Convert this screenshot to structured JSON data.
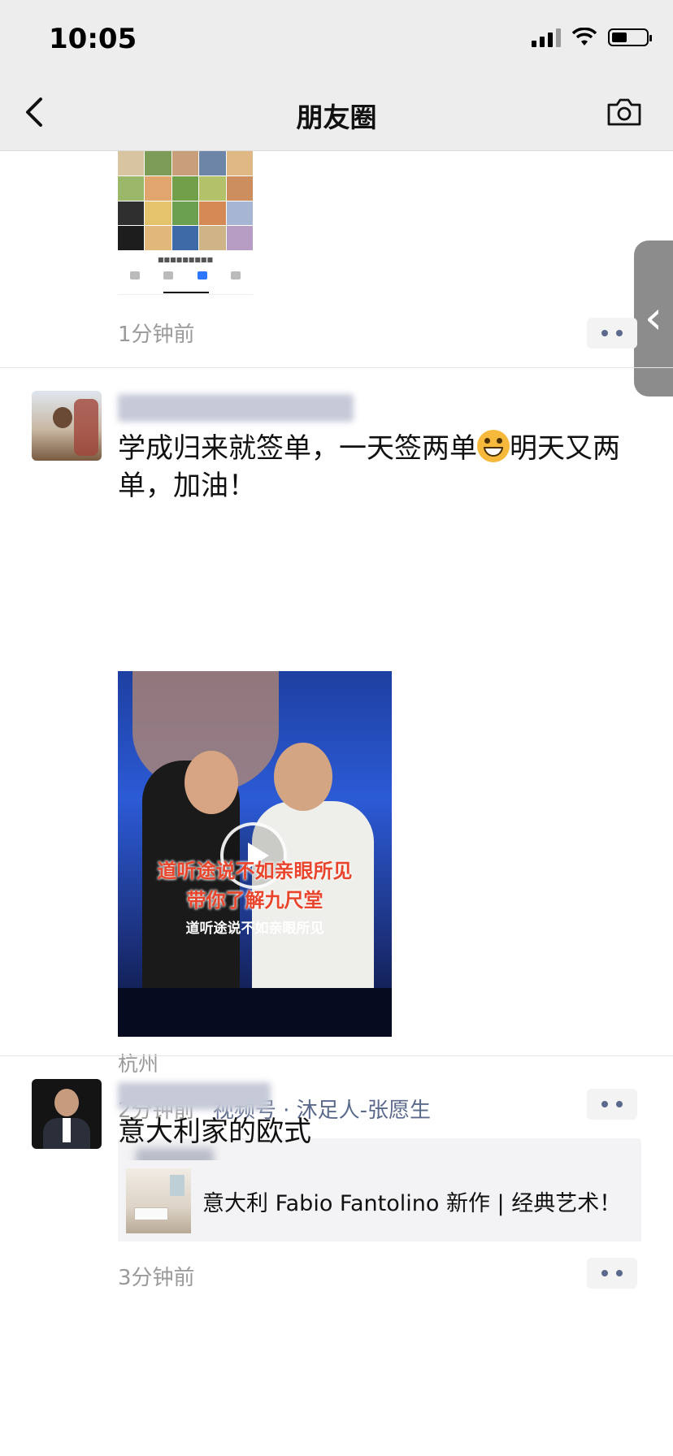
{
  "status_bar": {
    "time": "10:05",
    "battery_percent": 45
  },
  "nav": {
    "title": "朋友圈"
  },
  "posts": [
    {
      "time": "1分钟前"
    },
    {
      "text": "学成归来就签单，一天签两单",
      "text_after_emoji": "明天又两",
      "text_line2": "单，加油！",
      "video": {
        "caption_red_1": "道听途说不如亲眼所见",
        "caption_red_2": "带你了解九尺堂",
        "caption_white": "道听途说不如亲眼所见"
      },
      "location": "杭州",
      "time": "2分钟前",
      "source": "视频号 · 沐足人-张愿生"
    },
    {
      "text": "意大利家的欧式",
      "link_title": "意大利 Fabio Fantolino 新作 | 经典艺术！",
      "time": "3分钟前"
    }
  ],
  "icons": {
    "back": "chevron-left-icon",
    "camera": "camera-icon",
    "more": "more-dots-icon",
    "play": "play-icon",
    "side_tab": "chevron-left-icon"
  },
  "colors": {
    "link_blue": "#5b6a8c",
    "nav_bg": "#ededed",
    "side_tab": "#8c8c8c"
  }
}
